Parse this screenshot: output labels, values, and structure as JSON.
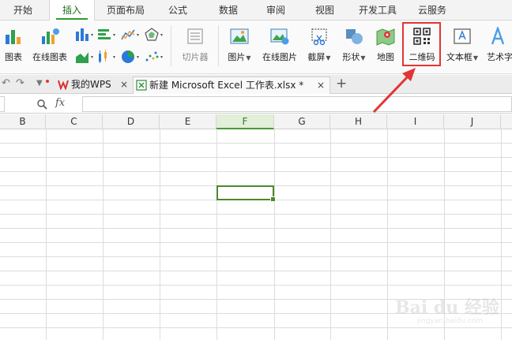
{
  "menu": {
    "tabs": [
      {
        "label": "开始"
      },
      {
        "label": "插入"
      },
      {
        "label": "页面布局"
      },
      {
        "label": "公式"
      },
      {
        "label": "数据"
      },
      {
        "label": "审阅"
      },
      {
        "label": "视图"
      },
      {
        "label": "开发工具"
      },
      {
        "label": "云服务"
      }
    ],
    "active": "插入"
  },
  "ribbon": {
    "chart": "图表",
    "online_chart": "在线图表",
    "slicer": "切片器",
    "picture": "图片",
    "online_picture": "在线图片",
    "screenshot": "截屏",
    "shapes": "形状",
    "map": "地图",
    "qrcode": "二维码",
    "textbox": "文本框",
    "wordart": "艺术字"
  },
  "doctabs": {
    "wps": "我的WPS",
    "file": "新建 Microsoft Excel 工作表.xlsx *",
    "close": "×",
    "add": "+"
  },
  "formula": {
    "fx": "fx",
    "value": ""
  },
  "grid": {
    "columns": [
      "B",
      "C",
      "D",
      "E",
      "F",
      "G",
      "H",
      "I",
      "J"
    ],
    "selected_column": "F"
  },
  "watermark": {
    "line1": "Bai du 经验",
    "line2": "jingyan.baidu.com"
  },
  "colors": {
    "accent": "#2c9c2c",
    "annotation": "#e23535"
  }
}
